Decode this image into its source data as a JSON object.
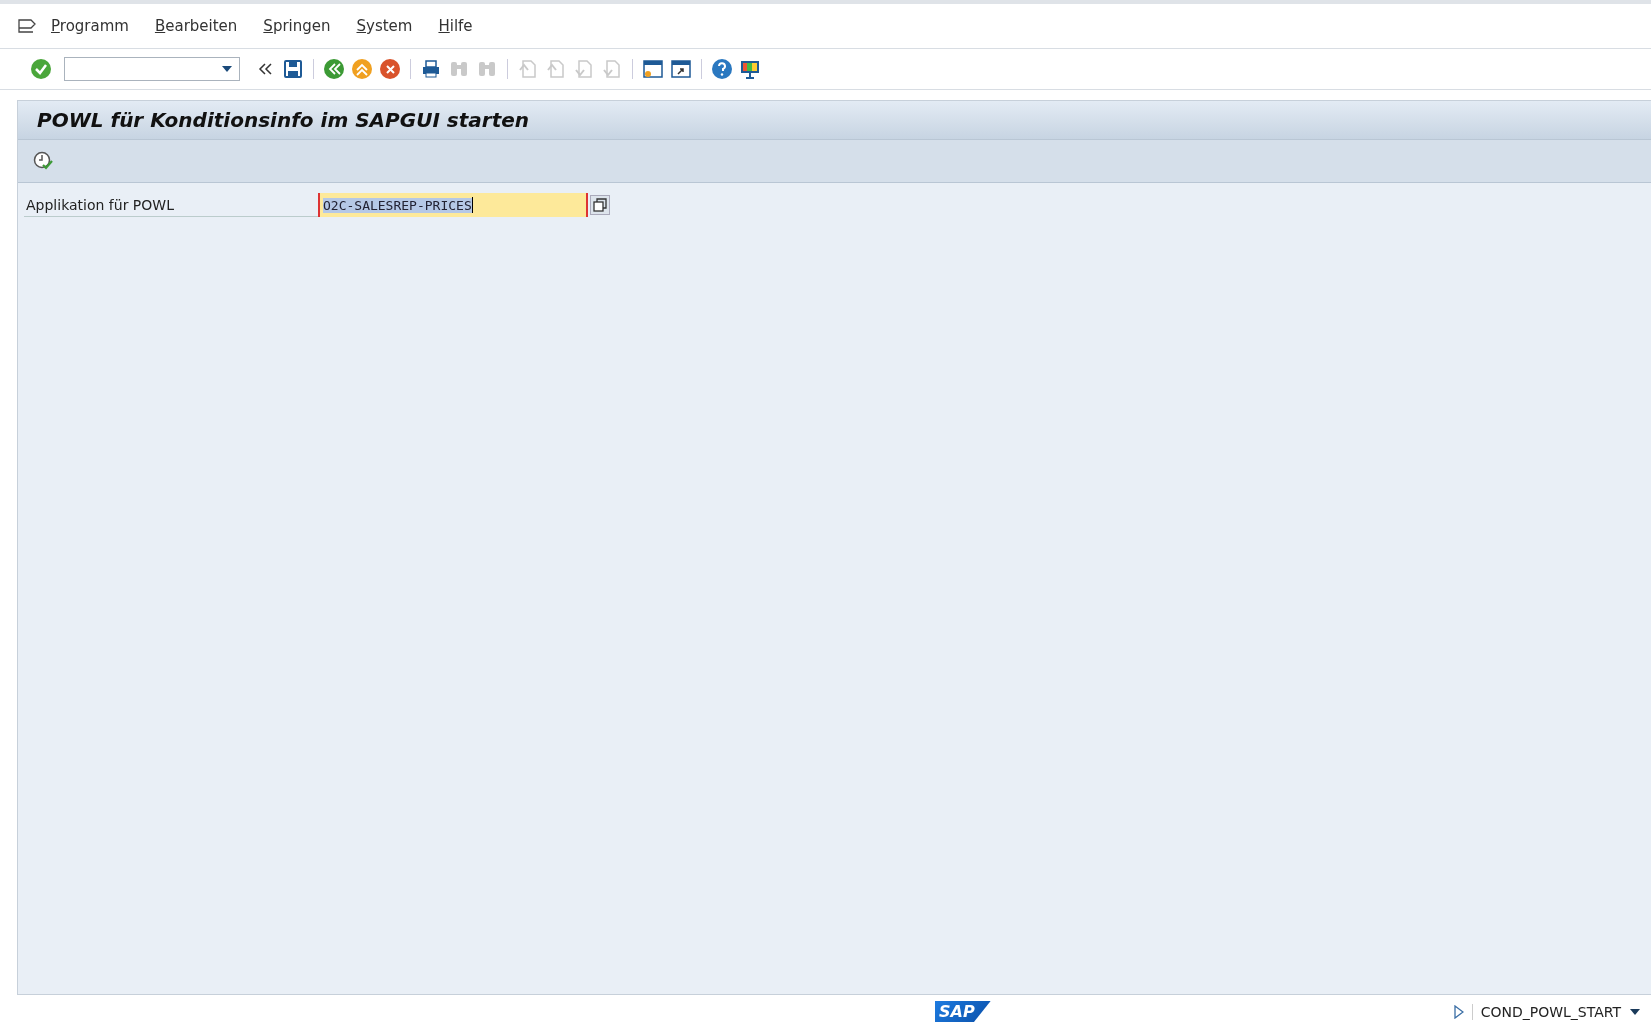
{
  "menu": [
    "Programm",
    "Bearbeiten",
    "Springen",
    "System",
    "Hilfe"
  ],
  "toolbar": [
    {
      "kind": "enter",
      "disabled": false
    },
    {
      "kind": "command"
    },
    {
      "kind": "collapse",
      "disabled": false
    },
    {
      "kind": "save",
      "disabled": false
    },
    {
      "kind": "sep"
    },
    {
      "kind": "back",
      "disabled": false
    },
    {
      "kind": "exit",
      "disabled": false
    },
    {
      "kind": "cancel",
      "disabled": false
    },
    {
      "kind": "sep"
    },
    {
      "kind": "print",
      "disabled": false
    },
    {
      "kind": "find",
      "disabled": true
    },
    {
      "kind": "findnext",
      "disabled": true
    },
    {
      "kind": "sep"
    },
    {
      "kind": "first",
      "disabled": true
    },
    {
      "kind": "prev",
      "disabled": true
    },
    {
      "kind": "next",
      "disabled": true
    },
    {
      "kind": "last",
      "disabled": true
    },
    {
      "kind": "sep"
    },
    {
      "kind": "newsession",
      "disabled": false
    },
    {
      "kind": "shortcut",
      "disabled": false
    },
    {
      "kind": "sep"
    },
    {
      "kind": "help",
      "disabled": false
    },
    {
      "kind": "layout",
      "disabled": false
    }
  ],
  "title": "POWL für Konditionsinfo im SAPGUI starten",
  "field": {
    "label": "Applikation für POWL",
    "value": "O2C-SALESREP-PRICES"
  },
  "status_bar": {
    "logo": "SAP",
    "transaction": "COND_POWL_START"
  }
}
